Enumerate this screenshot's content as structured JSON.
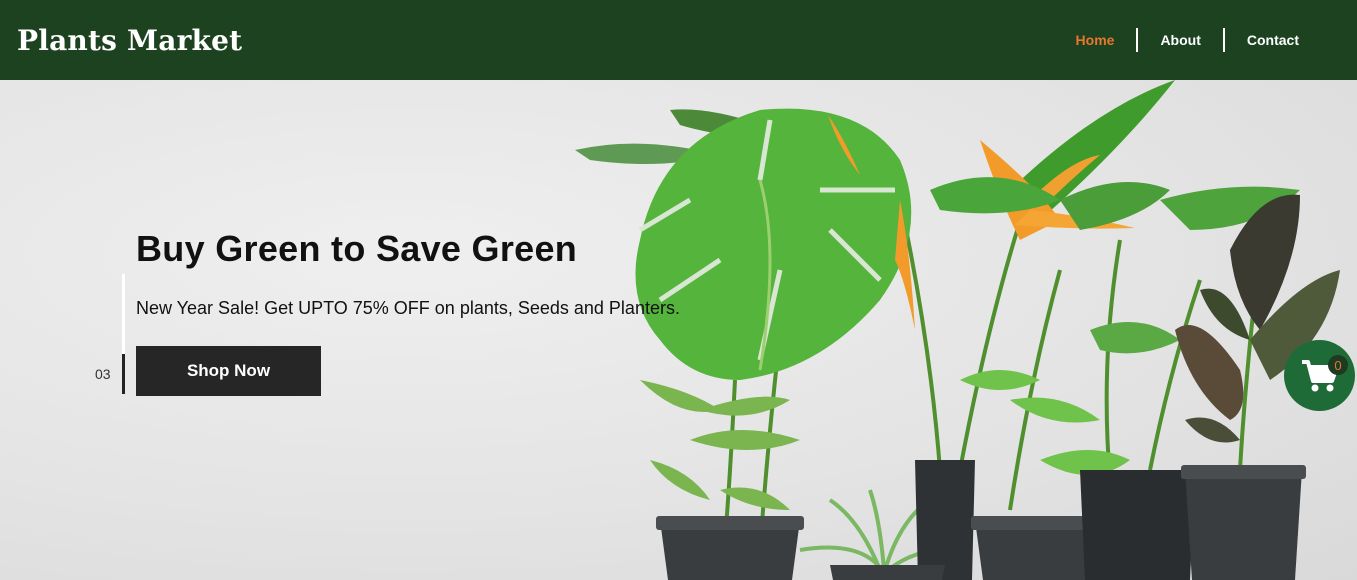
{
  "header": {
    "brand": "Plants Market",
    "nav": [
      {
        "label": "Home",
        "active": true
      },
      {
        "label": "About",
        "active": false
      },
      {
        "label": "Contact",
        "active": false
      }
    ]
  },
  "hero": {
    "headline": "Buy Green to Save Green",
    "subline": "New Year Sale! Get UPTO 75% OFF on plants, Seeds and Planters.",
    "cta_label": "Shop Now",
    "slide_number": "03"
  },
  "cart": {
    "count": "0",
    "icon": "shopping-cart-icon"
  },
  "colors": {
    "header_bg": "#1c4220",
    "accent": "#e8772e",
    "cart_bg": "#1f6b37",
    "button_bg": "#262626"
  }
}
